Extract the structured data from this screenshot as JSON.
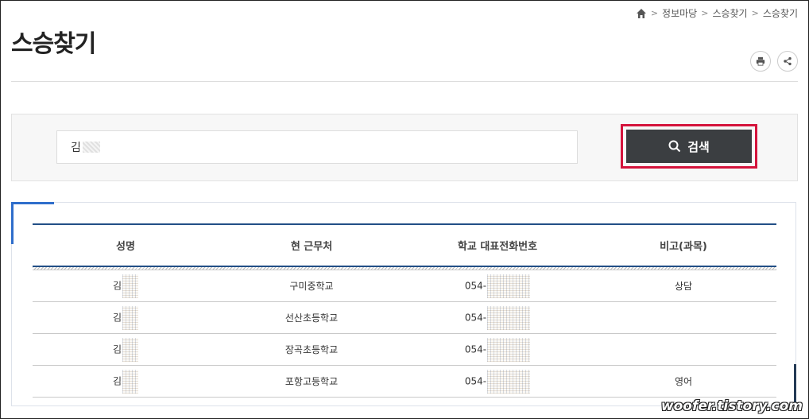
{
  "breadcrumb": {
    "items": [
      "정보마당",
      "스승찾기",
      "스승찾기"
    ],
    "separator": ">"
  },
  "page": {
    "title": "스승찾기"
  },
  "tools": {
    "print_icon": "print-icon",
    "share_icon": "share-icon"
  },
  "search": {
    "value": "김",
    "button_label": "검색"
  },
  "table": {
    "headers": [
      "성명",
      "현 근무처",
      "학교 대표전화번호",
      "비고(과목)"
    ],
    "rows": [
      {
        "name": "김",
        "school": "구미중학교",
        "phone": "054-",
        "note": "상담"
      },
      {
        "name": "김",
        "school": "선산초등학교",
        "phone": "054-",
        "note": ""
      },
      {
        "name": "김",
        "school": "장곡초등학교",
        "phone": "054-",
        "note": ""
      },
      {
        "name": "김",
        "school": "포항고등학교",
        "phone": "054-",
        "note": "영어"
      }
    ]
  },
  "watermark": "woofer.tistory.com",
  "colors": {
    "accent": "#2f6ecb",
    "button_bg": "#3b3e41",
    "highlight": "#d4143c",
    "table_top": "#224f86"
  }
}
